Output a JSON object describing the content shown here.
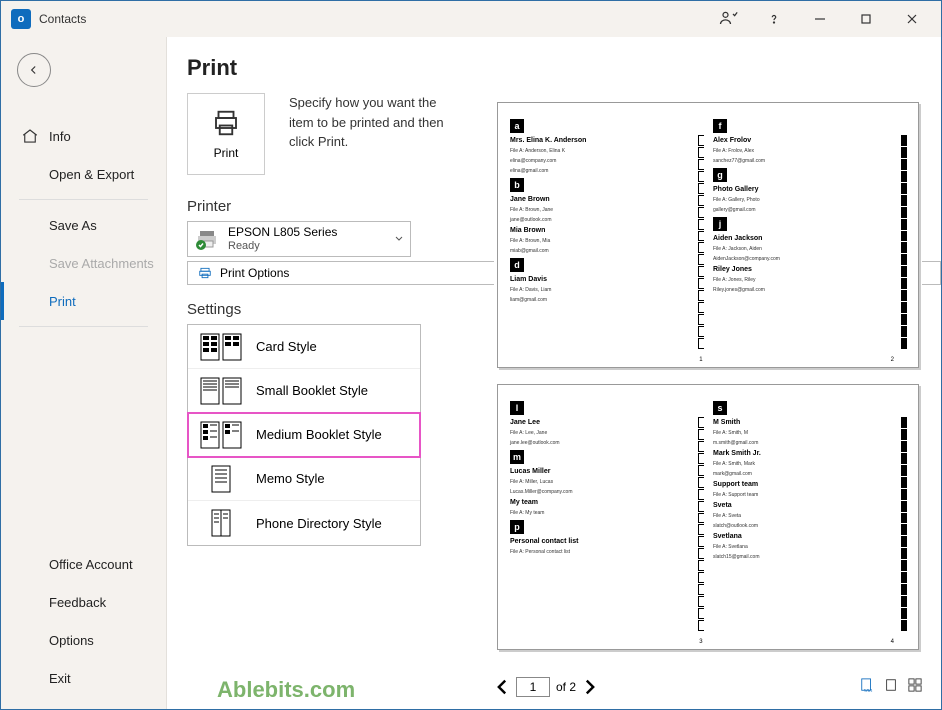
{
  "titlebar": {
    "title": "Contacts"
  },
  "sidebar": {
    "items": [
      {
        "label": "Info"
      },
      {
        "label": "Open & Export"
      },
      {
        "label": "Save As"
      },
      {
        "label": "Save Attachments"
      },
      {
        "label": "Print"
      }
    ],
    "bottom": [
      {
        "label": "Office Account"
      },
      {
        "label": "Feedback"
      },
      {
        "label": "Options"
      },
      {
        "label": "Exit"
      }
    ]
  },
  "page": {
    "title": "Print",
    "print_button": "Print",
    "description": "Specify how you want the item to be printed and then click Print.",
    "printer_section": "Printer",
    "printer_name": "EPSON L805 Series",
    "printer_status": "Ready",
    "print_options": "Print Options",
    "settings_section": "Settings",
    "settings": [
      "Card Style",
      "Small Booklet Style",
      "Medium Booklet Style",
      "Memo Style",
      "Phone Directory Style"
    ],
    "watermark": "Ablebits.com"
  },
  "pager": {
    "current": "1",
    "total_label": "of 2"
  },
  "preview": {
    "pages": [
      {
        "left_num": "1",
        "right_num": "2",
        "left": [
          {
            "letter": "a",
            "name": "Mrs. Elina K. Anderson",
            "l1": "File A:   Anderson, Elina K",
            "l2": "elina@company.com",
            "l3": "elina@gmail.com"
          },
          {
            "letter": "b",
            "name": "Jane Brown",
            "l1": "File A:   Brown, Jane",
            "l2": "jane@outlook.com"
          },
          {
            "letter": "",
            "name": "Mia Brown",
            "l1": "File A:   Brown, Mia",
            "l2": "miab@gmail.com"
          },
          {
            "letter": "d",
            "name": "Liam Davis",
            "l1": "File A:   Davis, Liam",
            "l2": "liam@gmail.com"
          }
        ],
        "right": [
          {
            "letter": "f",
            "name": "Alex Frolov",
            "l1": "File A:   Frolov, Alex",
            "l2": "sanchez77@gmail.com"
          },
          {
            "letter": "g",
            "name": "Photo Gallery",
            "l1": "File A:   Gallery, Photo",
            "l2": "gallery@gmail.com"
          },
          {
            "letter": "j",
            "name": "Aiden Jackson",
            "l1": "File A:   Jackson, Aiden",
            "l2": "AidenJackson@company.com"
          },
          {
            "letter": "",
            "name": "Riley Jones",
            "l1": "File A:   Jones, Riley",
            "l2": "Riley.jones@gmail.com"
          }
        ]
      },
      {
        "left_num": "3",
        "right_num": "4",
        "left": [
          {
            "letter": "l",
            "name": "Jane Lee",
            "l1": "File A:   Lee, Jane",
            "l2": "jane.lee@outlook.com"
          },
          {
            "letter": "m",
            "name": "Lucas Miller",
            "l1": "File A:   Miller, Lucas",
            "l2": "Lucas.Miller@company.com"
          },
          {
            "letter": "",
            "name": "My team",
            "l1": "File A:   My team"
          },
          {
            "letter": "p",
            "name": "Personal contact list",
            "l1": "File A:   Personal contact list"
          }
        ],
        "right": [
          {
            "letter": "s",
            "name": "M Smith",
            "l1": "File A:   Smith, M",
            "l2": "m.smith@gmail.com"
          },
          {
            "letter": "",
            "name": "Mark Smith Jr.",
            "l1": "File A:   Smith, Mark",
            "l2": "mark@gmail.com"
          },
          {
            "letter": "",
            "name": "Support team",
            "l1": "File A:   Support team"
          },
          {
            "letter": "",
            "name": "Sveta",
            "l1": "File A:   Sveta",
            "l2": "slatch@outlook.com"
          },
          {
            "letter": "",
            "name": "Svetlana",
            "l1": "File A:   Svetlana",
            "l2": "slatch15@gmail.com"
          }
        ]
      }
    ]
  }
}
